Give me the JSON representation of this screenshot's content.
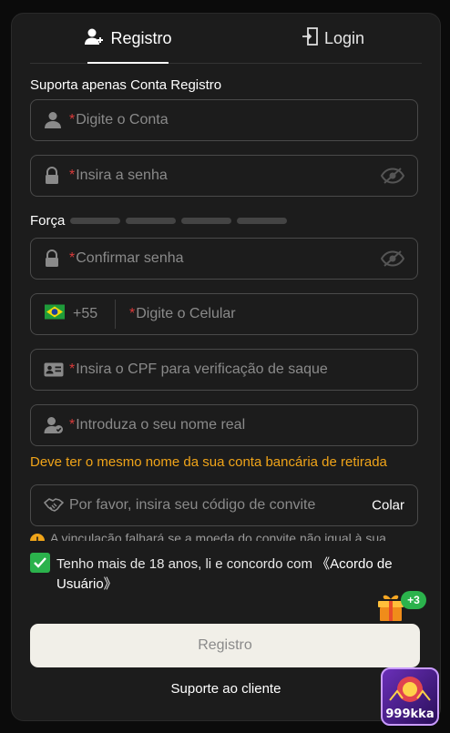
{
  "tabs": {
    "register": "Registro",
    "login": "Login"
  },
  "form": {
    "subtitle": "Suporta apenas Conta Registro",
    "required_mark": "*",
    "account_placeholder": "Digite o Conta",
    "password_placeholder": "Insira a senha",
    "strength_label": "Força",
    "confirm_placeholder": "Confirmar senha",
    "country_code": "+55",
    "phone_placeholder": "Digite o Celular",
    "cpf_placeholder": "Insira o CPF para verificação de saque",
    "name_placeholder": "Introduza o seu nome real",
    "name_warning": "Deve ter o mesmo nome da sua conta bancária de retirada",
    "invite_placeholder": "Por favor, insira seu código de convite",
    "paste_label": "Colar",
    "invite_note": "A vinculação falhará se a moeda do convite não igual à sua",
    "agree_text": "Tenho mais de 18 anos, li e concordo com ",
    "agree_link": "《Acordo de Usuário》",
    "agree_checked": true,
    "submit_label": "Registro",
    "support_label": "Suporte ao cliente"
  },
  "gift_badge": "+3",
  "logo_text": "999kka",
  "colors": {
    "accent": "#f0a419",
    "check": "#2bb24c",
    "required": "#d93a3a",
    "panel": "#1c1c1c"
  }
}
